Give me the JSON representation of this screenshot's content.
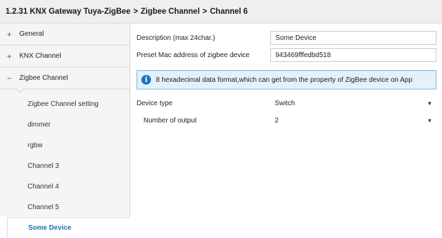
{
  "breadcrumb": {
    "device": "1.2.31 KNX Gateway Tuya-ZigBee",
    "section": "Zigbee Channel",
    "page": "Channel 6",
    "separator": ">"
  },
  "sidebar": {
    "groups": [
      {
        "label": "General",
        "state_symbol": "+"
      },
      {
        "label": "KNX Channel",
        "state_symbol": "+"
      },
      {
        "label": "Zigbee Channel",
        "state_symbol": "−"
      }
    ],
    "items": [
      {
        "label": "Zigbee Channel setting"
      },
      {
        "label": "dimmer"
      },
      {
        "label": "rgbw"
      },
      {
        "label": "Channel 3"
      },
      {
        "label": "Channel 4"
      },
      {
        "label": "Channel 5"
      },
      {
        "label": "Some Device",
        "selected": true
      }
    ]
  },
  "form": {
    "description": {
      "label": "Description (max 24char.)",
      "value": "Some Device"
    },
    "mac": {
      "label": "Preset Mac address of zigbee device",
      "value": "943469fffedbd518"
    },
    "info": {
      "icon": "info-icon",
      "text": "8 hexadecimal data format,which can get from the property of ZigBee device on App"
    },
    "device_type": {
      "label": "Device type",
      "value": "Switch"
    },
    "outputs": {
      "label": "Number of output",
      "value": "2"
    }
  },
  "colors": {
    "accent": "#1c6fb5",
    "info_bg": "#e3f1f8",
    "info_border": "#7fb8d8",
    "info_icon": "#1677c9"
  }
}
